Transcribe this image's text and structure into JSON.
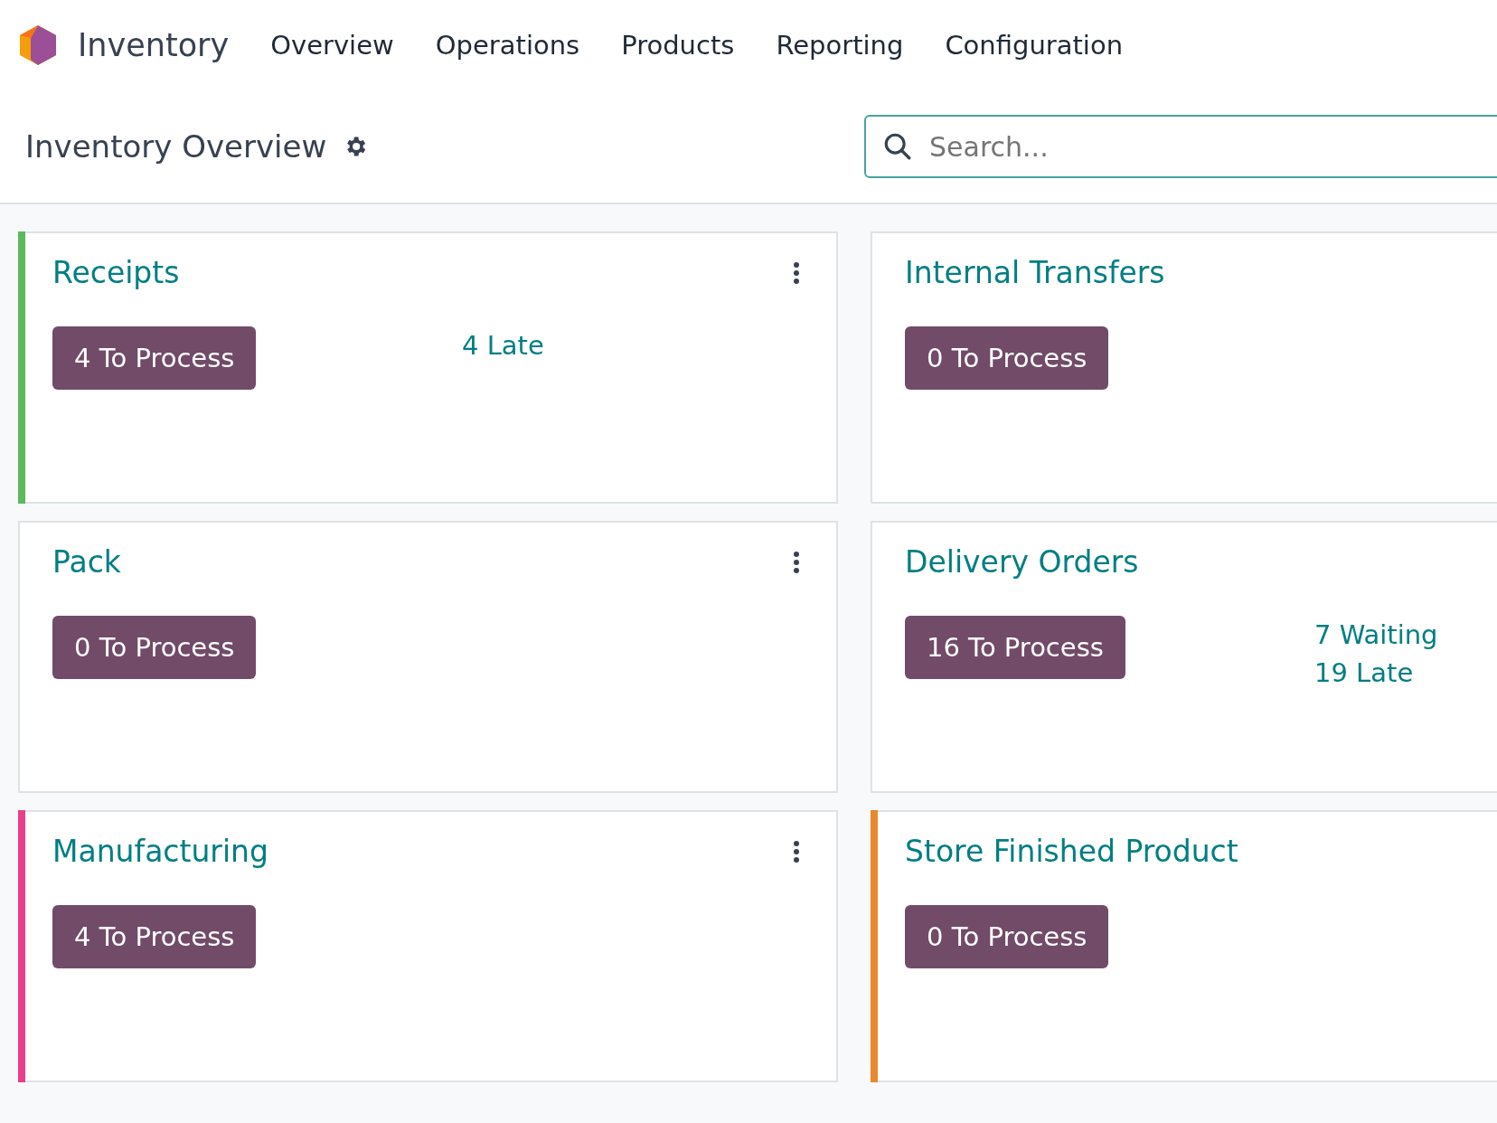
{
  "app": {
    "name": "Inventory"
  },
  "menu": [
    "Overview",
    "Operations",
    "Products",
    "Reporting",
    "Configuration"
  ],
  "page": {
    "title": "Inventory Overview"
  },
  "search": {
    "placeholder": "Search..."
  },
  "cards": [
    {
      "title": "Receipts",
      "button": "4 To Process",
      "stats": [
        "4 Late"
      ],
      "color": "#5cb85c"
    },
    {
      "title": "Internal Transfers",
      "button": "0 To Process"
    },
    {
      "title": "Pack",
      "button": "0 To Process"
    },
    {
      "title": "Delivery Orders",
      "button": "16 To Process",
      "stats": [
        "7 Waiting",
        "19 Late"
      ]
    },
    {
      "title": "Manufacturing",
      "button": "4 To Process",
      "color": "#e83e8c"
    },
    {
      "title": "Store Finished Product",
      "button": "0 To Process",
      "color": "#e8892e"
    }
  ]
}
